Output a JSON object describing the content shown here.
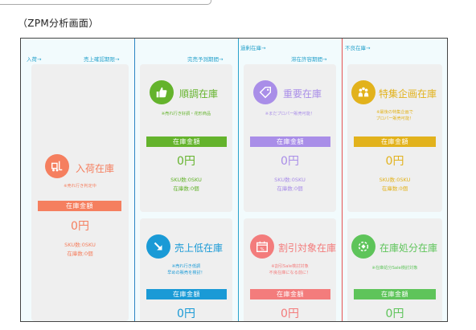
{
  "caption": "（ZPM分析画面）",
  "headers": {
    "h1": "入荷→",
    "h2": "売上確認期限→",
    "h3": "完売予測期間→",
    "h4": "過剰在庫→",
    "h5": "滞在許容期間→",
    "h6": "不良在庫→"
  },
  "panels": {
    "arrival": {
      "title": "入荷在庫",
      "note1": "※売れ行き判定中",
      "note2": "",
      "bar": "在庫金額",
      "amount": "0円",
      "sku": "SKU数:0SKU",
      "count": "在庫数:0個",
      "color": "#f57f5f",
      "icon": "forklift-icon"
    },
    "good": {
      "title": "順調在庫",
      "note1": "※売れ行き好調・花形商品",
      "note2": "",
      "bar": "在庫金額",
      "amount": "0円",
      "sku": "SKU数:0SKU",
      "count": "在庫数:0個",
      "color": "#64b32c",
      "icon": "thumbs-up-icon"
    },
    "key": {
      "title": "重要在庫",
      "note1": "※まだプロパー販売可能！",
      "note2": "",
      "bar": "在庫金額",
      "amount": "0円",
      "sku": "SKU数:0SKU",
      "count": "在庫数:0個",
      "color": "#a98ee8",
      "icon": "tag-icon"
    },
    "special": {
      "title": "特集企画在庫",
      "note1": "※最後の特集企画で",
      "note2": "プロパー販売可能！",
      "bar": "在庫金額",
      "amount": "0円",
      "sku": "SKU数:0SKU",
      "count": "在庫数:0個",
      "color": "#e2b21c",
      "icon": "group-icon"
    },
    "low": {
      "title": "売上低在庫",
      "note1": "※売れ行き低調",
      "note2": "早めの販売を検討！",
      "bar": "在庫金額",
      "amount": "0円",
      "color": "#1a9ad6",
      "icon": "arrow-down-right-icon"
    },
    "discount": {
      "title": "割引対象在庫",
      "note1": "※割引Sale検討対象",
      "note2": "不良在庫になる前に！",
      "bar": "在庫金額",
      "amount": "0円",
      "color": "#f37c7c",
      "icon": "calendar-discount-icon"
    },
    "disposal": {
      "title": "在庫処分在庫",
      "note1": "※在庫処分Sale検討対象",
      "note2": "",
      "bar": "在庫金額",
      "amount": "0円",
      "color": "#5ec45a",
      "icon": "disposal-icon"
    }
  }
}
